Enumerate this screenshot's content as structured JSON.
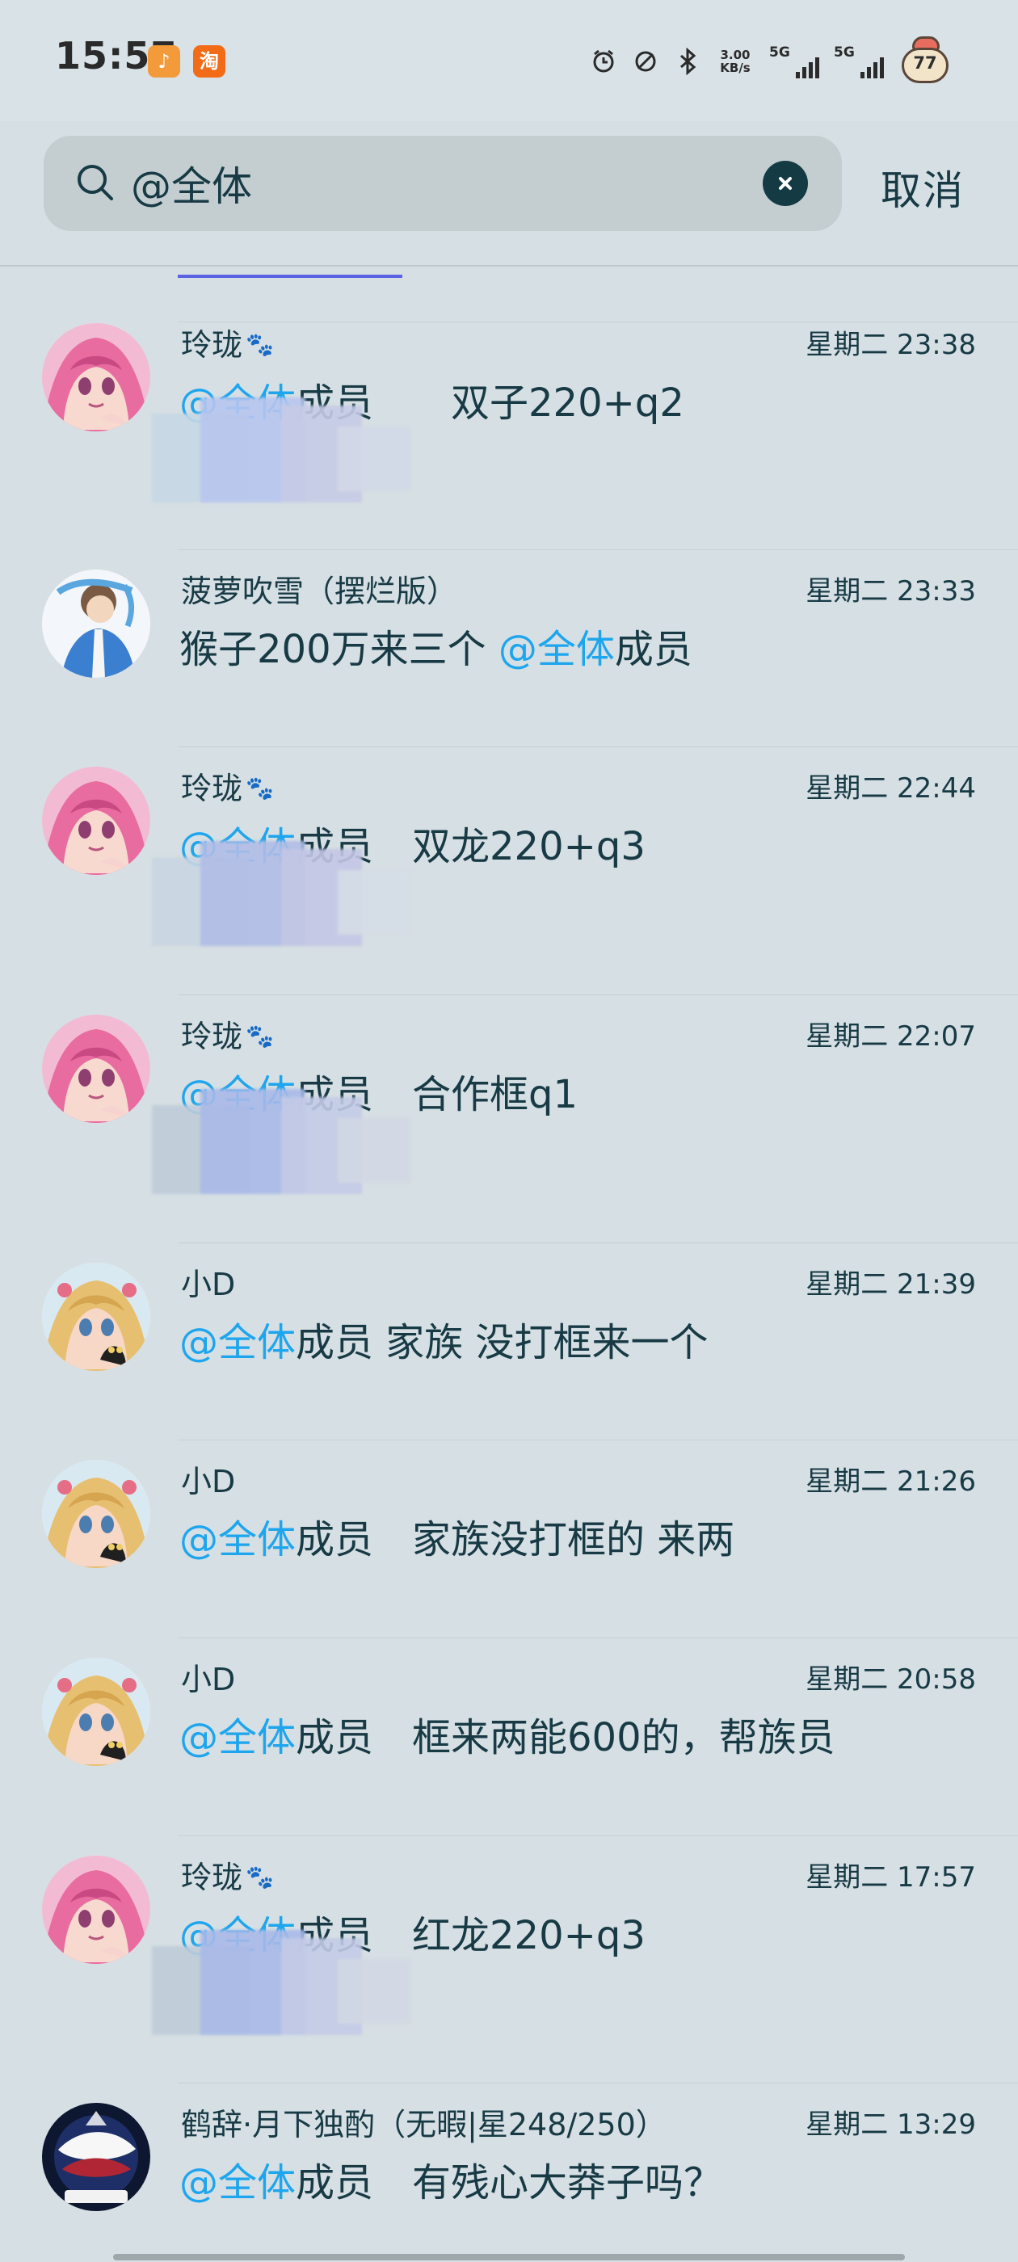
{
  "status_bar": {
    "time": "15:57",
    "app_badges": [
      {
        "name": "fliggy-app-icon",
        "glyph": "♪",
        "color": "#f39a3a"
      },
      {
        "name": "taobao-app-icon",
        "glyph": "淘",
        "color": "#f26c18"
      }
    ],
    "network_speed": "3.00",
    "network_unit": "KB/s",
    "signal_1": "5G",
    "signal_2": "5G",
    "battery_level": "77"
  },
  "search": {
    "query": "@全体",
    "cancel_label": "取消",
    "icon": "search-icon",
    "clear_icon": "clear-icon"
  },
  "results": [
    {
      "name": "玲珑",
      "paw": "🐾",
      "time": "星期二 23:38",
      "mention": "@全体",
      "text": "成员　　双子220+q2",
      "avatar": "pink-hair-avatar",
      "blurred": true
    },
    {
      "name": "菠萝吹雪（摆烂版）",
      "paw": "",
      "time": "星期二 23:33",
      "before": "猴子200万来三个 ",
      "mention": "@全体",
      "text": "成员",
      "avatar": "blue-coat-avatar",
      "blurred": false
    },
    {
      "name": "玲珑",
      "paw": "🐾",
      "time": "星期二 22:44",
      "mention": "@全体",
      "text": "成员　双龙220+q3",
      "avatar": "pink-hair-avatar",
      "blurred": true
    },
    {
      "name": "玲珑",
      "paw": "🐾",
      "time": "星期二 22:07",
      "mention": "@全体",
      "text": "成员　合作框q1",
      "avatar": "pink-hair-avatar",
      "blurred": true
    },
    {
      "name": "小D",
      "paw": "",
      "time": "星期二 21:39",
      "mention": "@全体",
      "text": "成员 家族 没打框来一个",
      "avatar": "blonde-girl-avatar",
      "blurred": false
    },
    {
      "name": "小D",
      "paw": "",
      "time": "星期二 21:26",
      "mention": "@全体",
      "text": "成员　家族没打框的 来两",
      "avatar": "blonde-girl-avatar",
      "blurred": false
    },
    {
      "name": "小D",
      "paw": "",
      "time": "星期二 20:58",
      "mention": "@全体",
      "text": "成员　框来两能600的，帮族员",
      "avatar": "blonde-girl-avatar",
      "blurred": false
    },
    {
      "name": "玲珑",
      "paw": "🐾",
      "time": "星期二 17:57",
      "mention": "@全体",
      "text": "成员　红龙220+q3",
      "avatar": "pink-hair-avatar",
      "blurred": true
    },
    {
      "name": "鹤辞·月下独酌（无暇|星248/250）",
      "paw": "",
      "time": "星期二 13:29",
      "mention": "@全体",
      "text": "成员　有残心大莽子吗？",
      "avatar": "ninja-game-avatar",
      "blurred": false
    }
  ]
}
